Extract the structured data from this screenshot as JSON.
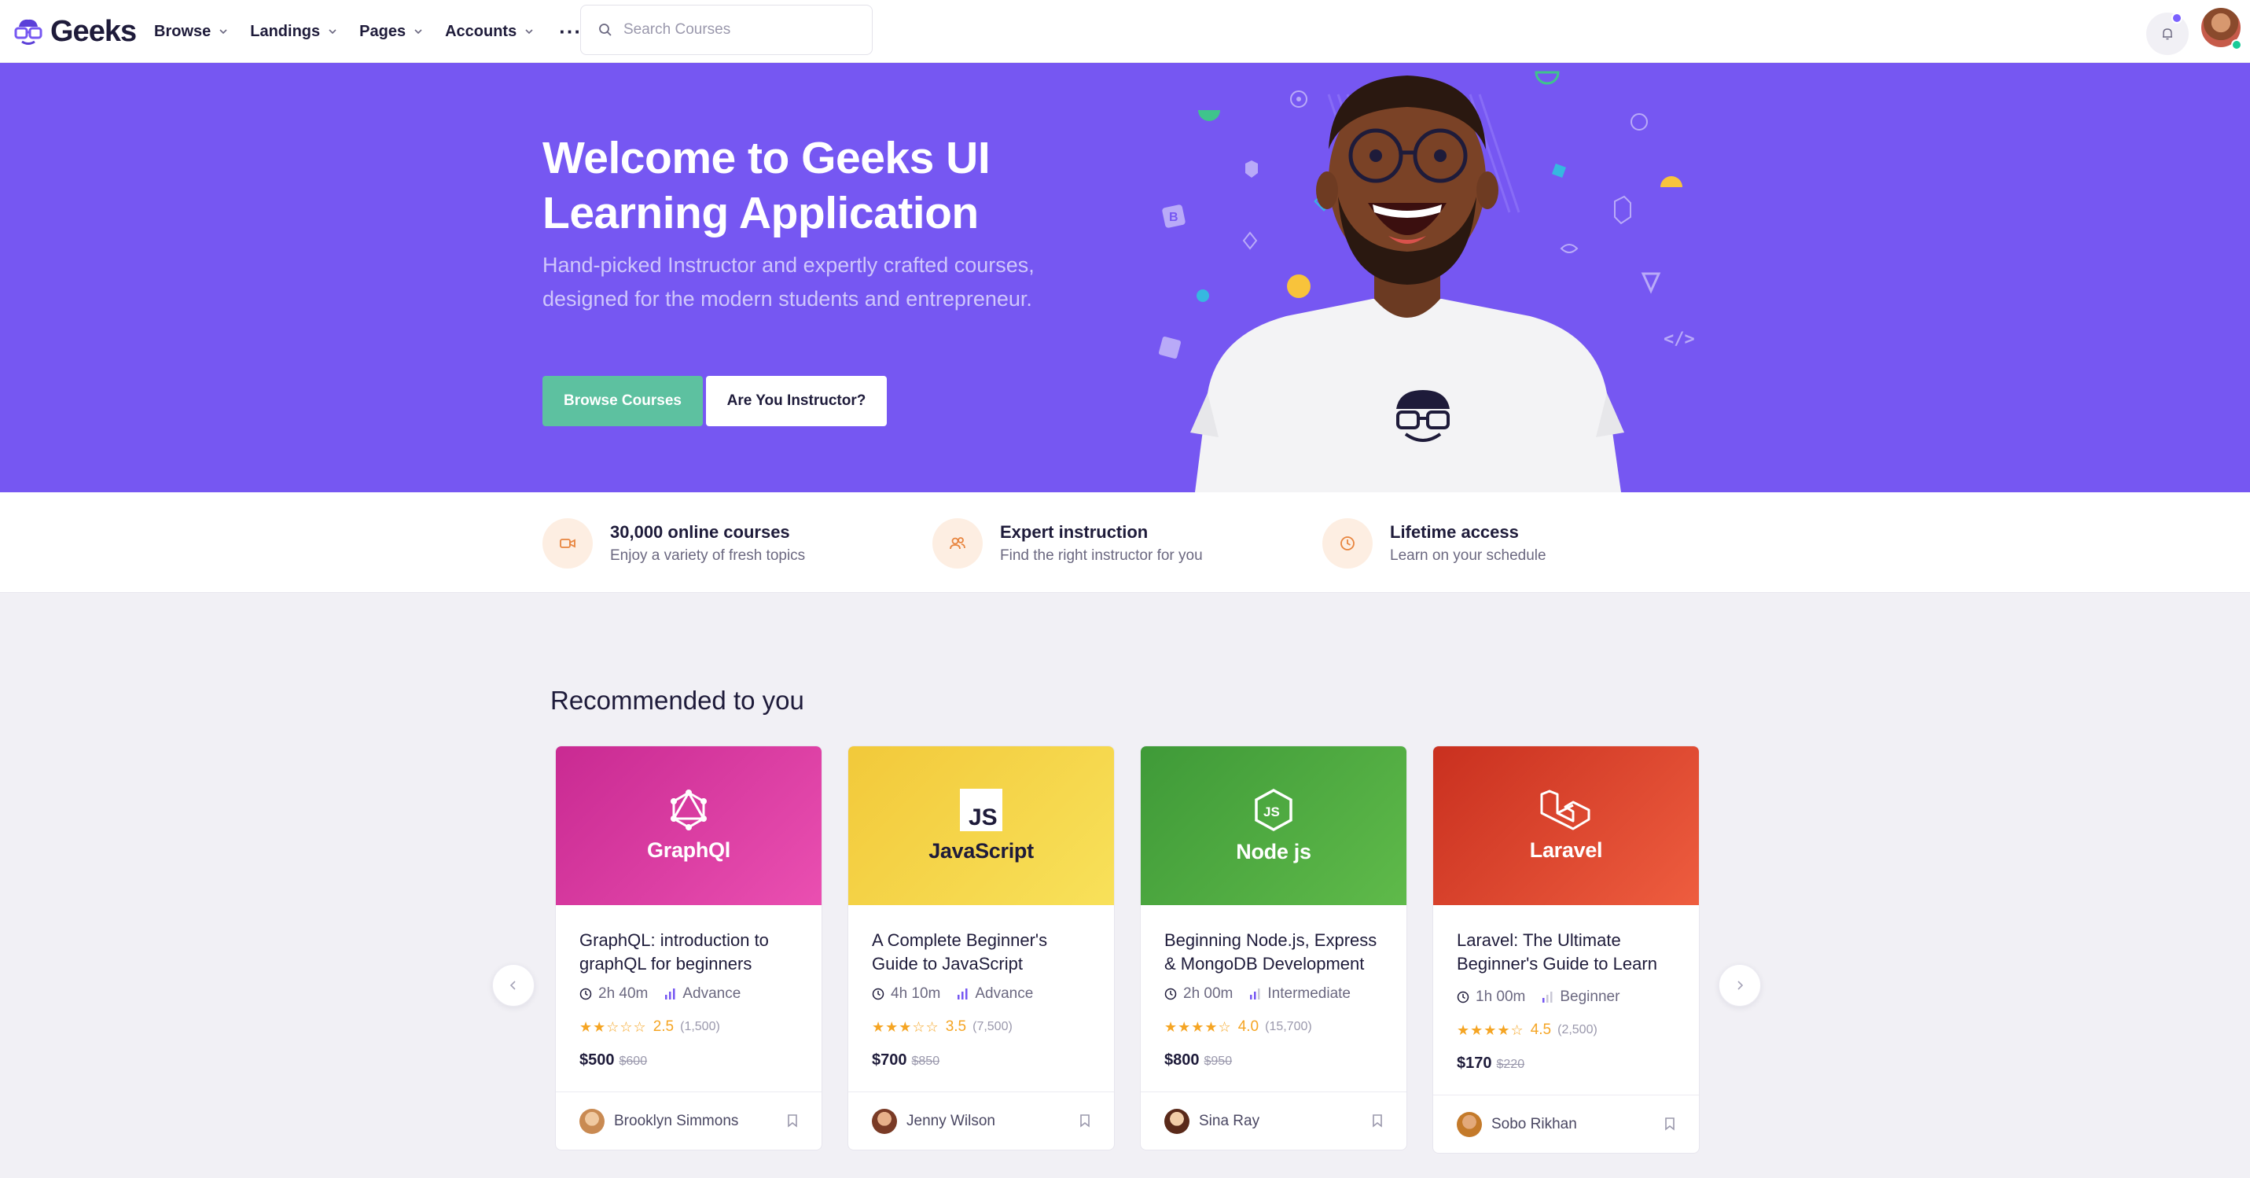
{
  "brand": {
    "name": "Geeks"
  },
  "nav": {
    "items": [
      {
        "label": "Browse"
      },
      {
        "label": "Landings"
      },
      {
        "label": "Pages"
      },
      {
        "label": "Accounts"
      }
    ],
    "more_icon": "more-horizontal-icon",
    "search_placeholder": "Search Courses"
  },
  "hero": {
    "title": "Welcome to Geeks UI Learning Application",
    "subtitle": "Hand-picked Instructor and expertly crafted courses, designed for the modern students and entrepreneur.",
    "primary_button": "Browse Courses",
    "secondary_button": "Are You Instructor?",
    "background_color": "#7657f2"
  },
  "features": [
    {
      "icon": "video-icon",
      "title": "30,000 online courses",
      "desc": "Enjoy a variety of fresh topics"
    },
    {
      "icon": "users-icon",
      "title": "Expert instruction",
      "desc": "Find the right instructor for you"
    },
    {
      "icon": "clock-icon",
      "title": "Lifetime access",
      "desc": "Learn on your schedule"
    }
  ],
  "recommended": {
    "title": "Recommended to you",
    "courses": [
      {
        "brand": "GraphQl",
        "title": "GraphQL: introduction to graphQL for beginners",
        "duration": "2h 40m",
        "level": "Advance",
        "rating": "2.5",
        "stars": "★★☆☆☆",
        "reviews": "(1,500)",
        "price": "$500",
        "old_price": "$600",
        "author": "Brooklyn Simmons",
        "color": "#e22fa3"
      },
      {
        "brand": "JavaScript",
        "title": "A Complete Beginner's Guide to JavaScript",
        "duration": "4h 10m",
        "level": "Advance",
        "rating": "3.5",
        "stars": "★★★☆☆",
        "reviews": "(7,500)",
        "price": "$700",
        "old_price": "$850",
        "author": "Jenny Wilson",
        "color": "#f5d637"
      },
      {
        "brand": "Node js",
        "title": "Beginning Node.js, Express & MongoDB Development",
        "duration": "2h 00m",
        "level": "Intermediate",
        "rating": "4.0",
        "stars": "★★★★☆",
        "reviews": "(15,700)",
        "price": "$800",
        "old_price": "$950",
        "author": "Sina Ray",
        "color": "#4caa3c"
      },
      {
        "brand": "Laravel",
        "title": "Laravel: The Ultimate Beginner's Guide to Learn",
        "duration": "1h 00m",
        "level": "Beginner",
        "rating": "4.5",
        "stars": "★★★★☆",
        "reviews": "(2,500)",
        "price": "$170",
        "old_price": "$220",
        "author": "Sobo Rikhan",
        "color": "#e64a32"
      }
    ]
  }
}
